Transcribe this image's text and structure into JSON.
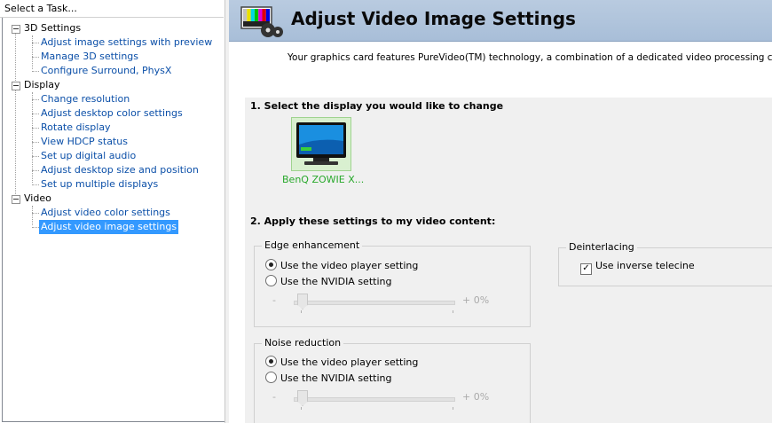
{
  "left_panel": {
    "header": "Select a Task...",
    "categories": [
      {
        "label": "3D Settings",
        "items": [
          "Adjust image settings with preview",
          "Manage 3D settings",
          "Configure Surround, PhysX"
        ]
      },
      {
        "label": "Display",
        "items": [
          "Change resolution",
          "Adjust desktop color settings",
          "Rotate display",
          "View HDCP status",
          "Set up digital audio",
          "Adjust desktop size and position",
          "Set up multiple displays"
        ]
      },
      {
        "label": "Video",
        "items": [
          "Adjust video color settings",
          "Adjust video image settings"
        ]
      }
    ],
    "selected_item": "Adjust video image settings"
  },
  "banner": {
    "title": "Adjust Video Image Settings",
    "icon": "video-settings-icon"
  },
  "intro": "Your graphics card features PureVideo(TM) technology, a combination of a dedicated video processing core and sof",
  "section1": {
    "title": "1. Select the display you would like to change",
    "display_label": "BenQ ZOWIE X..."
  },
  "section2": {
    "title": "2. Apply these settings to my video content:"
  },
  "edge_enhancement": {
    "title": "Edge enhancement",
    "option_player": "Use the video player setting",
    "option_nvidia": "Use the NVIDIA setting",
    "selected": "player",
    "slider_min_symbol": "-",
    "slider_value": "+ 0%",
    "slider_level": 0
  },
  "noise_reduction": {
    "title": "Noise reduction",
    "option_player": "Use the video player setting",
    "option_nvidia": "Use the NVIDIA setting",
    "selected": "player",
    "slider_min_symbol": "-",
    "slider_value": "+ 0%",
    "slider_level": 0
  },
  "deinterlacing": {
    "title": "Deinterlacing",
    "checkbox_label": "Use inverse telecine",
    "checked": true
  },
  "colors": {
    "link": "#0b4fa8",
    "selection": "#3399ff",
    "banner": "#b0c4dc",
    "display_label": "#27a82a"
  }
}
